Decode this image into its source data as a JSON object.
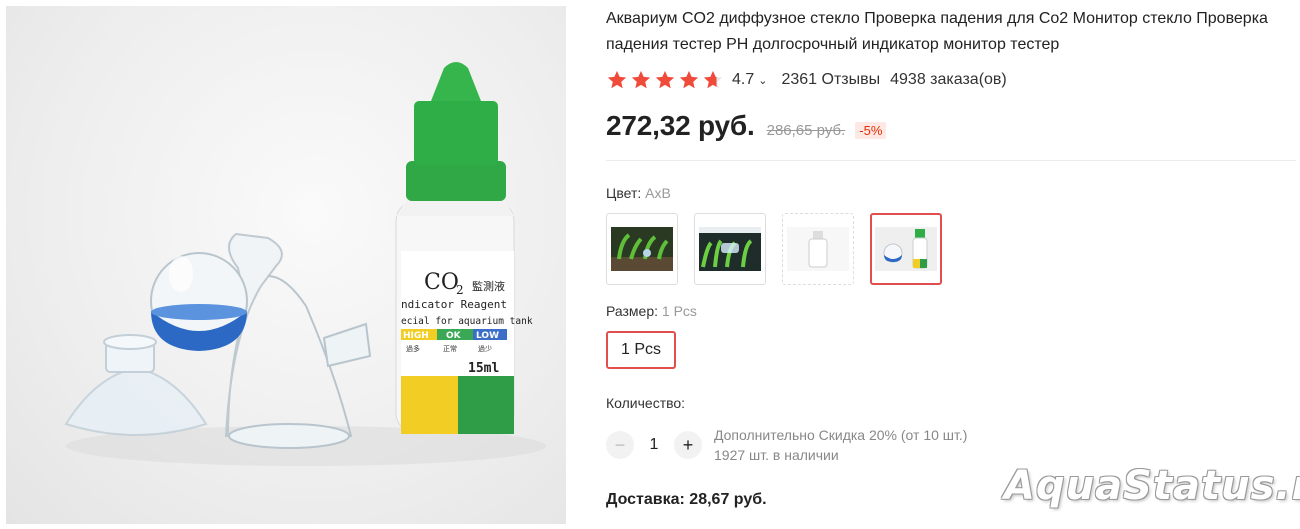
{
  "product": {
    "title": "Аквариум CO2 диффузное стекло Проверка падения для Co2 Монитор стекло Проверка падения тестер PH долгосрочный индикатор монитор тестер",
    "image_icon": "product-photo",
    "bottle_text": {
      "co2": "CO",
      "sub2": "2",
      "chinese": "監測液",
      "reagent": "ndicator Reagent",
      "tank": "ecial for aquarium tank",
      "high": "HIGH",
      "ok": "OK",
      "low": "LOW",
      "c1": "過多",
      "c2": "正常",
      "c3": "過少",
      "volume": "15ml"
    }
  },
  "rating": {
    "value": "4.7",
    "stars": 4.7,
    "star_color": "#f04a3b",
    "reviews": "2361 Отзывы",
    "orders": "4938 заказа(ов)"
  },
  "price": {
    "current": "272,32 руб.",
    "old": "286,65 руб.",
    "discount": "-5%",
    "discount_color": "#e62e04"
  },
  "color": {
    "label": "Цвет:",
    "value": "AxB",
    "selected_index": 3
  },
  "size": {
    "label": "Размер:",
    "value": "1 Pcs",
    "option": "1 Pcs"
  },
  "quantity": {
    "label": "Количество:",
    "value": "1",
    "minus": "−",
    "plus": "+",
    "discount_note": "Дополнительно Скидка 20% (от 10 шт.)",
    "stock": "1927 шт. в наличии"
  },
  "delivery": {
    "text": "Доставка: 28,67 руб."
  },
  "watermark": "AquaStatus.ru",
  "accent_color": "#e04e4e"
}
